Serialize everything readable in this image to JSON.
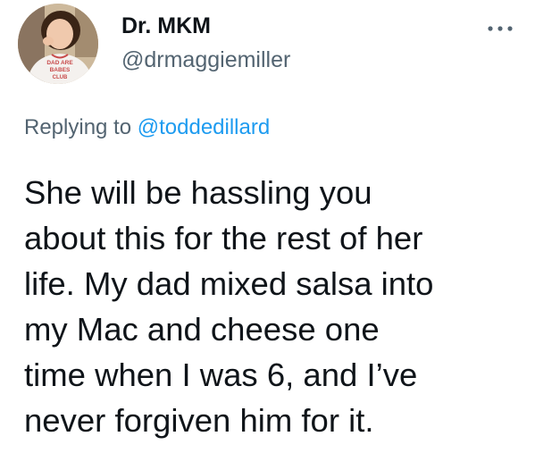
{
  "author": {
    "display_name": "Dr. MKM",
    "handle": "@drmaggiemiller",
    "avatar": "profile-photo",
    "avatar_shirt_text": [
      "DAD ARE",
      "BABES",
      "CLUB"
    ]
  },
  "more_icon": "more-dots-icon",
  "reply": {
    "prefix": "Replying to",
    "mention": "@toddedillard"
  },
  "tweet_lines": [
    "She will be hassling you",
    "about this for the rest of her",
    "life. My dad mixed salsa into",
    "my Mac and cheese one",
    "time when I was 6, and I’ve",
    "never forgiven him for it."
  ],
  "colors": {
    "text": "#0f1419",
    "secondary": "#536471",
    "accent": "#1d9bf0"
  }
}
